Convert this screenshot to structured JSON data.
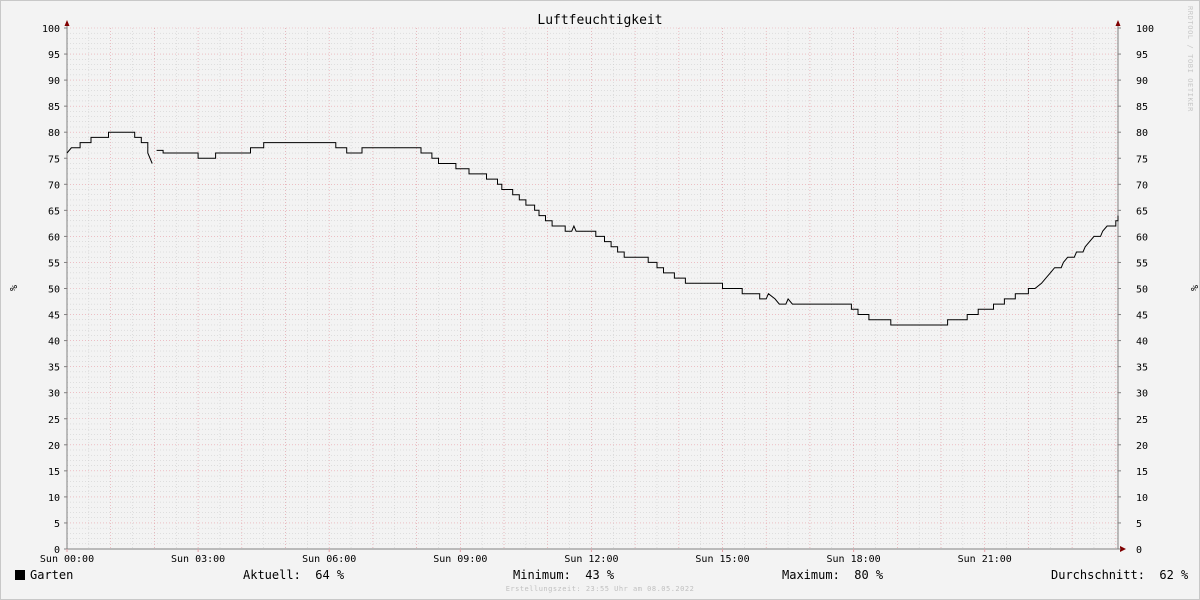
{
  "watermark": "RRDTOOL / TOBI OETIKER",
  "footer": "Erstellungszeit: 23:55 Uhr am 08.05.2022",
  "legend": {
    "series_name": "Garten",
    "current_label": "Aktuell:",
    "current_value": "64 %",
    "min_label": "Minimum:",
    "min_value": "43 %",
    "max_label": "Maximum:",
    "max_value": "80 %",
    "avg_label": "Durchschnitt:",
    "avg_value": "62 %"
  },
  "colors": {
    "line": "#000000",
    "major_grid": "#e8a0a8",
    "minor_grid": "#c8c8c8",
    "axis": "#808080",
    "arrow": "#800000"
  },
  "chart_data": {
    "type": "line",
    "title": "Luftfeuchtigkeit",
    "ylabel": "%",
    "ylim": [
      0,
      100
    ],
    "xlim": [
      0,
      24
    ],
    "x_unit": "hours",
    "yticks": [
      0,
      5,
      10,
      15,
      20,
      25,
      30,
      35,
      40,
      45,
      50,
      55,
      60,
      65,
      70,
      75,
      80,
      85,
      90,
      95,
      100
    ],
    "xticks": [
      {
        "x": 0,
        "label": "Sun 00:00"
      },
      {
        "x": 3,
        "label": "Sun 03:00"
      },
      {
        "x": 6,
        "label": "Sun 06:00"
      },
      {
        "x": 9,
        "label": "Sun 09:00"
      },
      {
        "x": 12,
        "label": "Sun 12:00"
      },
      {
        "x": 15,
        "label": "Sun 15:00"
      },
      {
        "x": 18,
        "label": "Sun 18:00"
      },
      {
        "x": 21,
        "label": "Sun 21:00"
      }
    ],
    "grid": true,
    "series": [
      {
        "name": "Garten",
        "segments": [
          [
            [
              0.0,
              76
            ],
            [
              0.1,
              77
            ],
            [
              0.3,
              77
            ],
            [
              0.3,
              78
            ],
            [
              0.55,
              78
            ],
            [
              0.55,
              79
            ],
            [
              0.95,
              79
            ],
            [
              0.95,
              80
            ],
            [
              1.55,
              80
            ],
            [
              1.55,
              79
            ],
            [
              1.7,
              79
            ],
            [
              1.7,
              78
            ],
            [
              1.85,
              78
            ],
            [
              1.85,
              76
            ],
            [
              1.95,
              74
            ]
          ],
          [
            [
              2.05,
              76.5
            ],
            [
              2.2,
              76.5
            ],
            [
              2.2,
              76
            ],
            [
              3.0,
              76
            ],
            [
              3.0,
              75
            ],
            [
              3.4,
              75
            ],
            [
              3.4,
              76
            ],
            [
              4.2,
              76
            ],
            [
              4.2,
              77
            ],
            [
              4.5,
              77
            ],
            [
              4.5,
              78
            ],
            [
              6.15,
              78
            ],
            [
              6.15,
              77
            ],
            [
              6.4,
              77
            ],
            [
              6.4,
              76
            ],
            [
              6.75,
              76
            ],
            [
              6.75,
              77
            ],
            [
              8.1,
              77
            ],
            [
              8.1,
              76
            ],
            [
              8.35,
              76
            ],
            [
              8.35,
              75
            ],
            [
              8.5,
              75
            ],
            [
              8.5,
              74
            ],
            [
              8.9,
              74
            ],
            [
              8.9,
              73
            ],
            [
              9.2,
              73
            ],
            [
              9.2,
              72
            ],
            [
              9.6,
              72
            ],
            [
              9.6,
              71
            ],
            [
              9.85,
              71
            ],
            [
              9.85,
              70
            ],
            [
              9.95,
              70
            ],
            [
              9.95,
              69
            ],
            [
              10.2,
              69
            ],
            [
              10.2,
              68
            ],
            [
              10.35,
              68
            ],
            [
              10.35,
              67
            ],
            [
              10.5,
              67
            ],
            [
              10.5,
              66
            ],
            [
              10.7,
              66
            ],
            [
              10.7,
              65
            ],
            [
              10.8,
              65
            ],
            [
              10.8,
              64
            ],
            [
              10.95,
              64
            ],
            [
              10.95,
              63
            ],
            [
              11.1,
              63
            ],
            [
              11.1,
              62
            ],
            [
              11.4,
              62
            ],
            [
              11.4,
              61
            ],
            [
              11.55,
              61
            ],
            [
              11.6,
              62
            ],
            [
              11.65,
              61
            ],
            [
              12.1,
              61
            ],
            [
              12.1,
              60
            ],
            [
              12.3,
              60
            ],
            [
              12.3,
              59
            ],
            [
              12.45,
              59
            ],
            [
              12.45,
              58
            ],
            [
              12.6,
              58
            ],
            [
              12.6,
              57
            ],
            [
              12.75,
              57
            ],
            [
              12.75,
              56
            ],
            [
              13.3,
              56
            ],
            [
              13.3,
              55
            ],
            [
              13.5,
              55
            ],
            [
              13.5,
              54
            ],
            [
              13.65,
              54
            ],
            [
              13.65,
              53
            ],
            [
              13.9,
              53
            ],
            [
              13.9,
              52
            ],
            [
              14.15,
              52
            ],
            [
              14.15,
              51
            ],
            [
              15.0,
              51
            ],
            [
              15.0,
              50
            ],
            [
              15.45,
              50
            ],
            [
              15.45,
              49
            ],
            [
              15.85,
              49
            ],
            [
              15.85,
              48
            ],
            [
              16.0,
              48
            ],
            [
              16.05,
              49
            ],
            [
              16.2,
              48
            ],
            [
              16.3,
              47
            ],
            [
              16.45,
              47
            ],
            [
              16.5,
              48
            ],
            [
              16.6,
              47
            ],
            [
              17.95,
              47
            ],
            [
              17.95,
              46
            ],
            [
              18.1,
              46
            ],
            [
              18.1,
              45
            ],
            [
              18.35,
              45
            ],
            [
              18.35,
              44
            ],
            [
              18.85,
              44
            ],
            [
              18.85,
              43
            ],
            [
              20.15,
              43
            ],
            [
              20.15,
              44
            ],
            [
              20.6,
              44
            ],
            [
              20.6,
              45
            ],
            [
              20.85,
              45
            ],
            [
              20.85,
              46
            ],
            [
              21.2,
              46
            ],
            [
              21.2,
              47
            ],
            [
              21.45,
              47
            ],
            [
              21.45,
              48
            ],
            [
              21.7,
              48
            ],
            [
              21.7,
              49
            ],
            [
              22.0,
              49
            ],
            [
              22.0,
              50
            ],
            [
              22.15,
              50
            ],
            [
              22.3,
              51
            ],
            [
              22.4,
              52
            ],
            [
              22.5,
              53
            ],
            [
              22.6,
              54
            ],
            [
              22.75,
              54
            ],
            [
              22.8,
              55
            ],
            [
              22.9,
              56
            ],
            [
              23.05,
              56
            ],
            [
              23.1,
              57
            ],
            [
              23.25,
              57
            ],
            [
              23.3,
              58
            ],
            [
              23.4,
              59
            ],
            [
              23.5,
              60
            ],
            [
              23.65,
              60
            ],
            [
              23.7,
              61
            ],
            [
              23.8,
              62
            ],
            [
              24.0,
              62
            ],
            [
              24.0,
              63
            ],
            [
              24.3,
              63
            ],
            [
              24.3,
              64
            ],
            [
              24.55,
              64
            ]
          ]
        ]
      }
    ]
  }
}
